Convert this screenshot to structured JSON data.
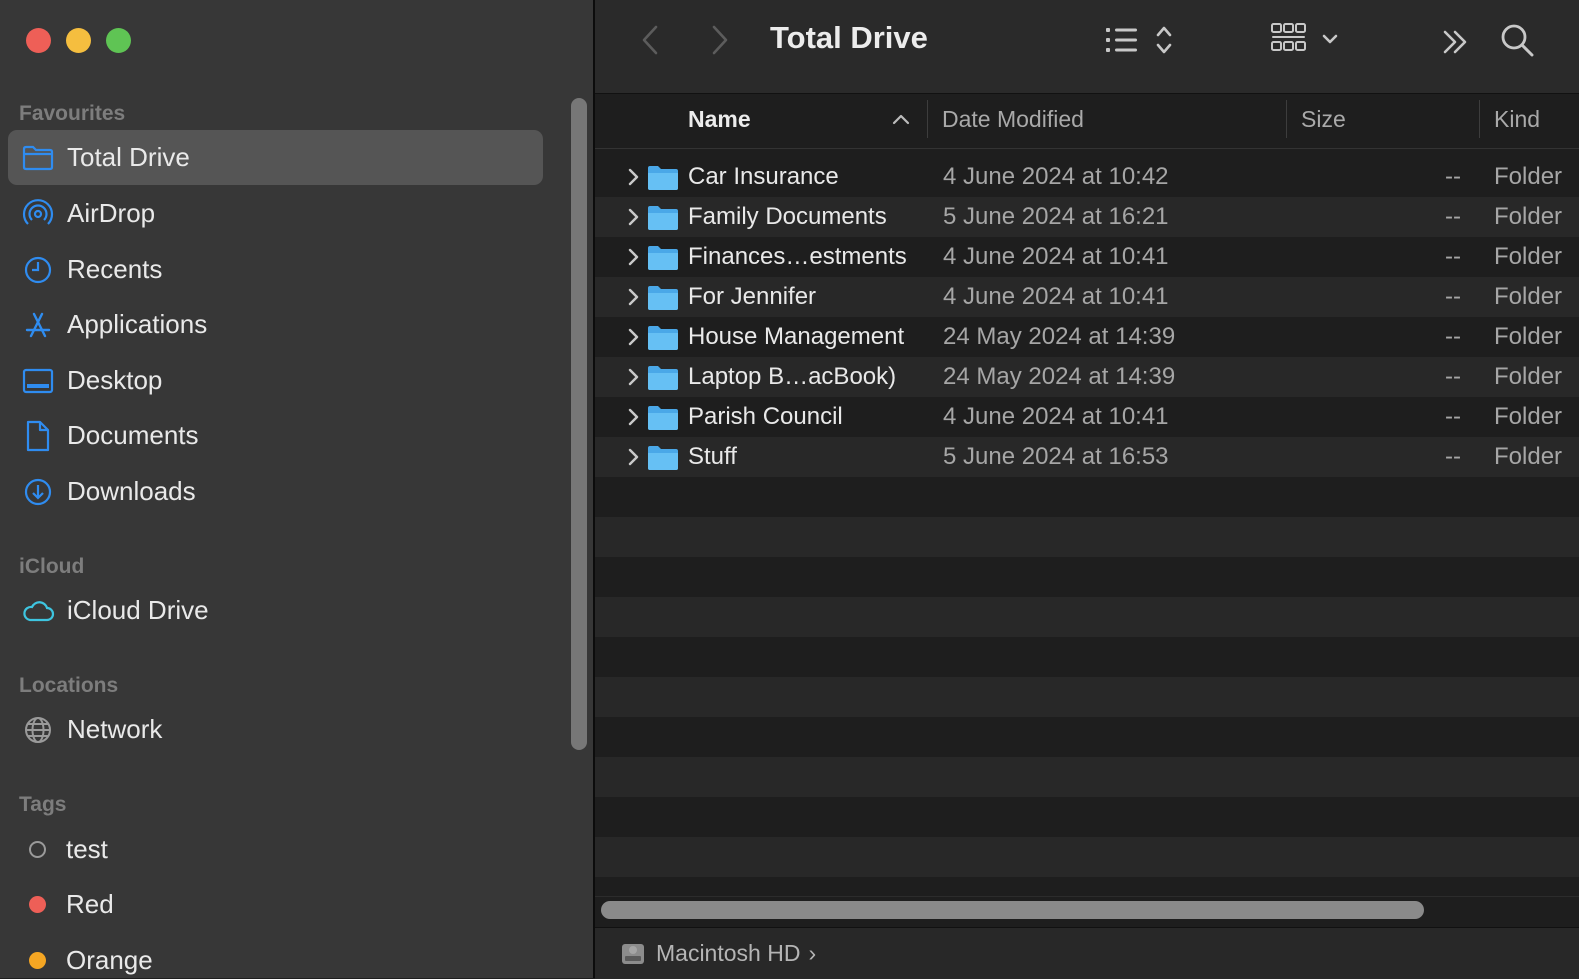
{
  "window": {
    "title": "Total Drive"
  },
  "sidebar": {
    "sections": {
      "favourites": "Favourites",
      "icloud": "iCloud",
      "locations": "Locations",
      "tags": "Tags"
    },
    "favourites": [
      {
        "label": "Total Drive",
        "icon": "folder-icon",
        "selected": true
      },
      {
        "label": "AirDrop",
        "icon": "airdrop-icon"
      },
      {
        "label": "Recents",
        "icon": "clock-icon"
      },
      {
        "label": "Applications",
        "icon": "applications-icon"
      },
      {
        "label": "Desktop",
        "icon": "desktop-icon"
      },
      {
        "label": "Documents",
        "icon": "document-icon"
      },
      {
        "label": "Downloads",
        "icon": "download-icon"
      }
    ],
    "icloud": [
      {
        "label": "iCloud Drive",
        "icon": "cloud-icon"
      }
    ],
    "locations": [
      {
        "label": "Network",
        "icon": "globe-icon"
      }
    ],
    "tags": [
      {
        "label": "test",
        "color": ""
      },
      {
        "label": "Red",
        "color": "#ee5f57"
      },
      {
        "label": "Orange",
        "color": "#f5a623"
      }
    ]
  },
  "columns": {
    "name": "Name",
    "date": "Date Modified",
    "size": "Size",
    "kind": "Kind"
  },
  "files": [
    {
      "name": "Car Insurance",
      "date": "4 June 2024 at 10:42",
      "size": "--",
      "kind": "Folder"
    },
    {
      "name": "Family Documents",
      "date": "5 June 2024 at 16:21",
      "size": "--",
      "kind": "Folder"
    },
    {
      "name": "Finances…estments",
      "date": "4 June 2024 at 10:41",
      "size": "--",
      "kind": "Folder"
    },
    {
      "name": "For Jennifer",
      "date": "4 June 2024 at 10:41",
      "size": "--",
      "kind": "Folder"
    },
    {
      "name": "House Management",
      "date": "24 May 2024 at 14:39",
      "size": "--",
      "kind": "Folder"
    },
    {
      "name": "Laptop B…acBook)",
      "date": "24 May 2024 at 14:39",
      "size": "--",
      "kind": "Folder"
    },
    {
      "name": "Parish Council",
      "date": "4 June 2024 at 10:41",
      "size": "--",
      "kind": "Folder"
    },
    {
      "name": "Stuff",
      "date": "5 June 2024 at 16:53",
      "size": "--",
      "kind": "Folder"
    }
  ],
  "pathbar": {
    "label": "Macintosh HD",
    "separator": "›"
  },
  "colors": {
    "accent": "#2f8cf0",
    "folder": "#5ab3ee",
    "close": "#ee5f57",
    "minimize": "#f5be3f",
    "maximize": "#5fc454"
  }
}
